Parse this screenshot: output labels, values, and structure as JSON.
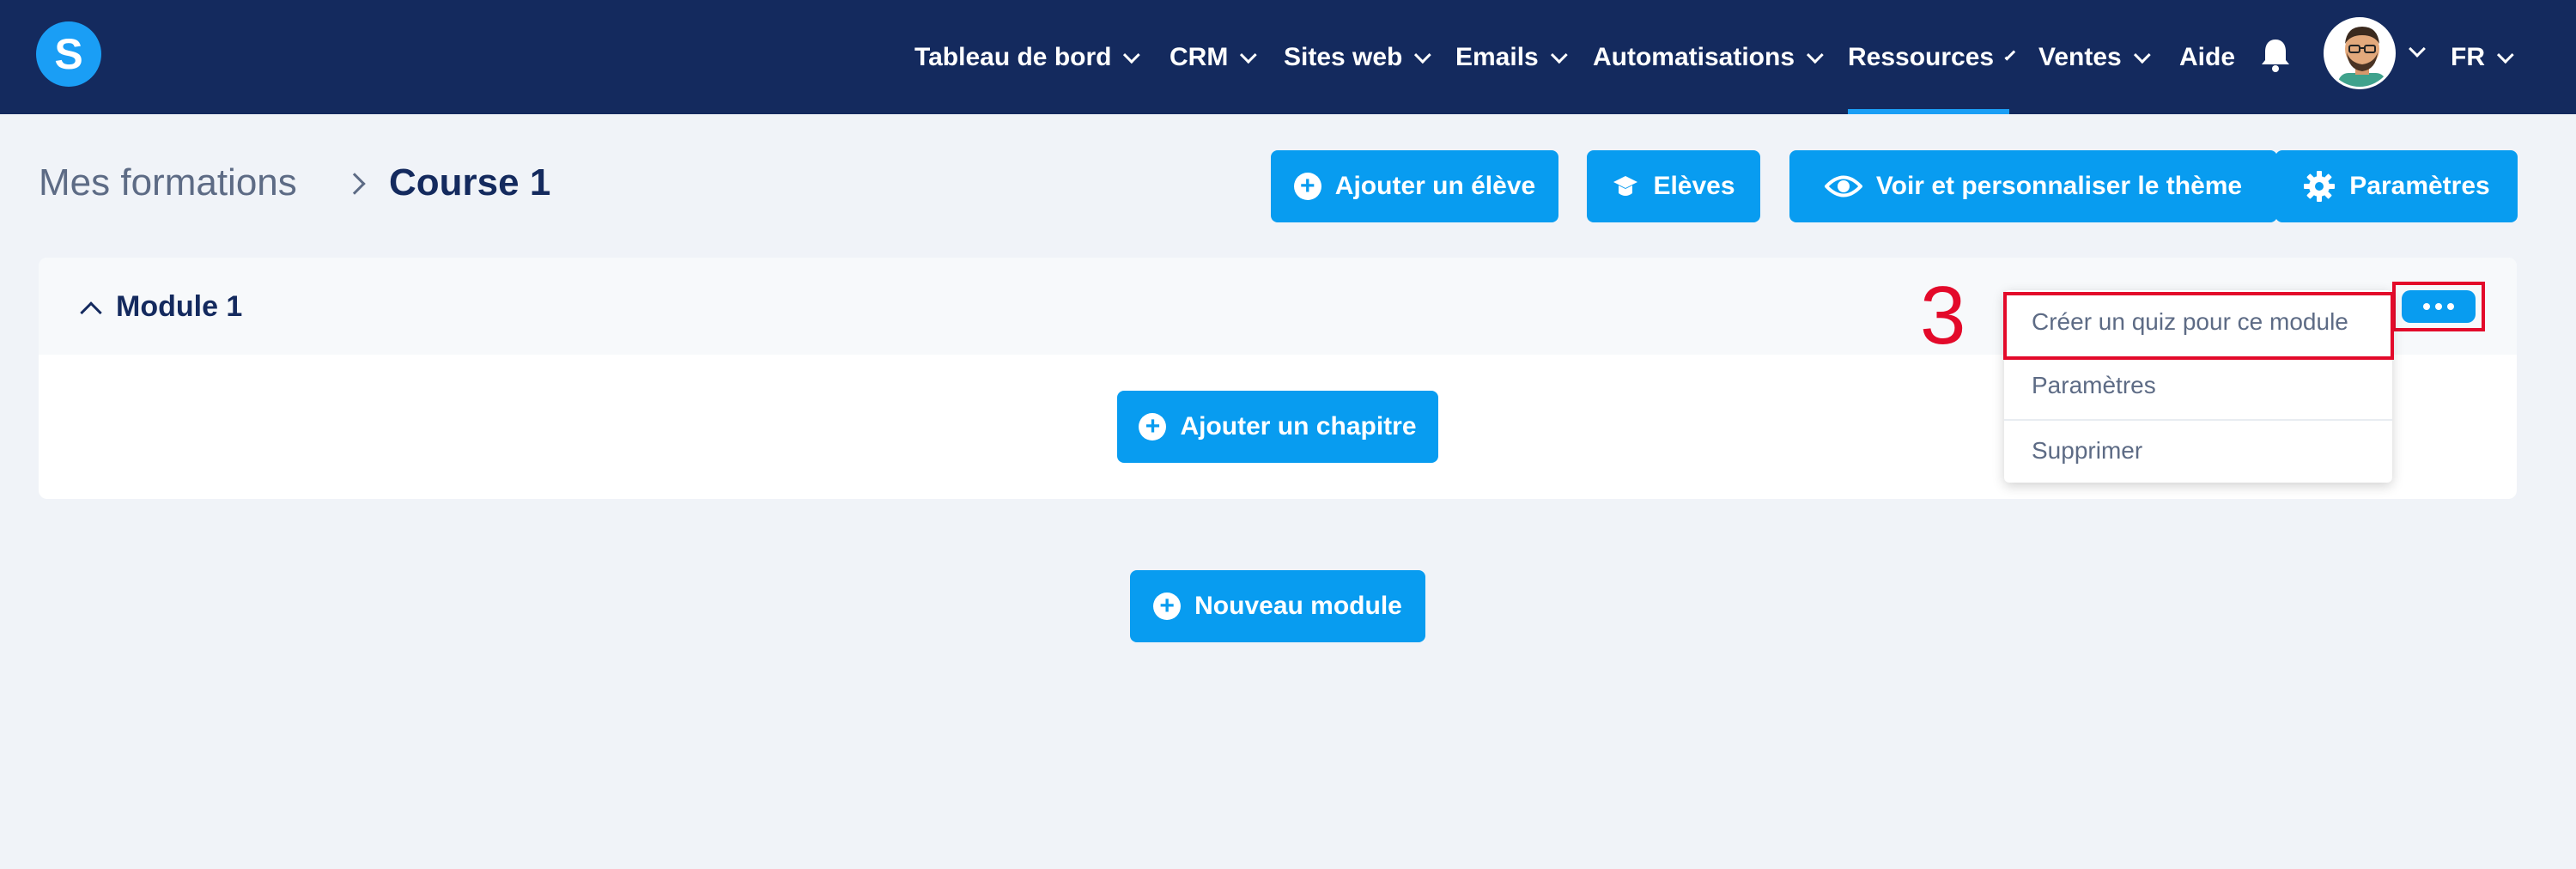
{
  "brand": {
    "logo_letter": "S"
  },
  "nav": {
    "items": [
      {
        "label": "Tableau de bord",
        "dropdown": true
      },
      {
        "label": "CRM",
        "dropdown": true
      },
      {
        "label": "Sites web",
        "dropdown": true
      },
      {
        "label": "Emails",
        "dropdown": true
      },
      {
        "label": "Automatisations",
        "dropdown": true
      },
      {
        "label": "Ressources",
        "dropdown": true,
        "active": true
      },
      {
        "label": "Ventes",
        "dropdown": true
      },
      {
        "label": "Aide",
        "dropdown": false
      }
    ],
    "language": "FR"
  },
  "breadcrumb": {
    "parent": "Mes formations",
    "current": "Course 1"
  },
  "actions": {
    "add_student": "Ajouter un élève",
    "students": "Elèves",
    "theme": "Voir et personnaliser le thème",
    "settings": "Paramètres"
  },
  "module": {
    "title": "Module 1",
    "add_chapter": "Ajouter un chapitre"
  },
  "new_module": "Nouveau module",
  "dropdown": {
    "items": [
      "Créer un quiz pour ce module",
      "Paramètres",
      "Supprimer"
    ]
  },
  "annotation": {
    "step": "3"
  },
  "colors": {
    "nav_bg": "#142a5e",
    "accent": "#089cf0",
    "highlight": "#e30a2a",
    "page_bg": "#f0f3f8"
  }
}
